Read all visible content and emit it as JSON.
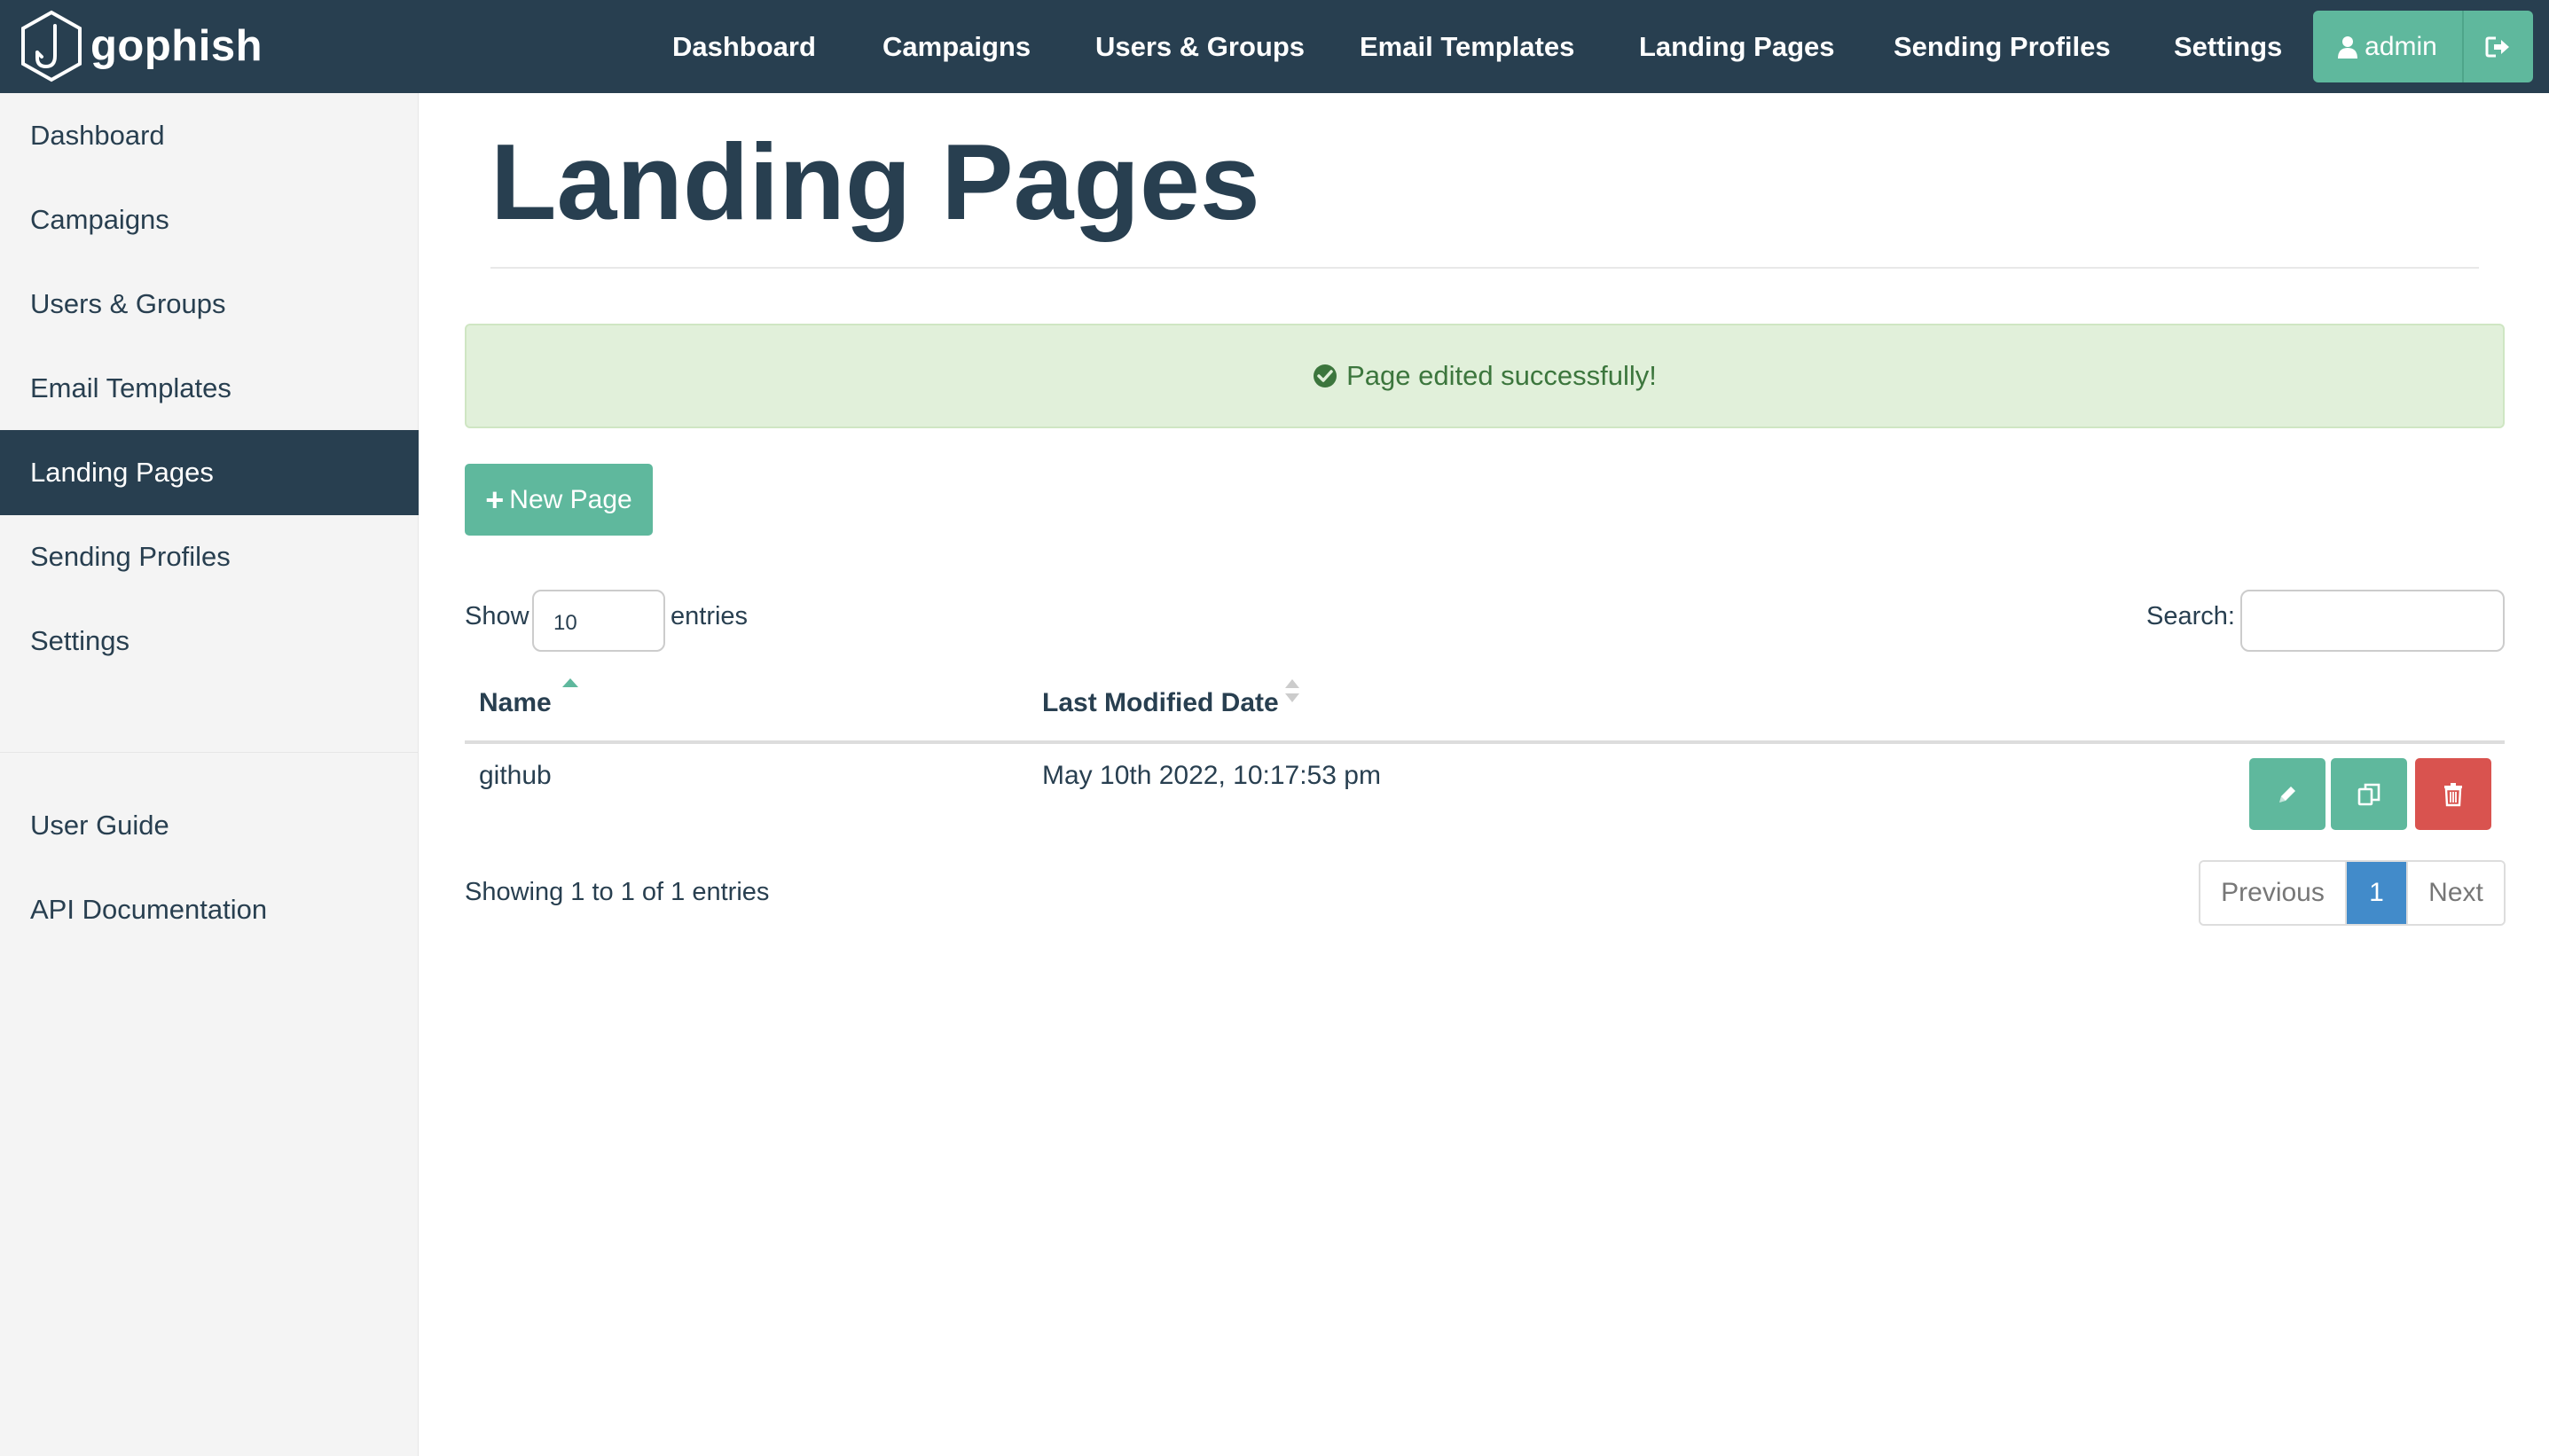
{
  "brand": {
    "name": "gophish",
    "logo_icon": "fishhook-hexagon-icon"
  },
  "topnav": {
    "items": [
      {
        "label": "Dashboard"
      },
      {
        "label": "Campaigns"
      },
      {
        "label": "Users & Groups"
      },
      {
        "label": "Email Templates"
      },
      {
        "label": "Landing Pages"
      },
      {
        "label": "Sending Profiles"
      },
      {
        "label": "Settings"
      }
    ],
    "user_label": "admin",
    "user_icon": "user-icon",
    "logout_icon": "sign-out-icon"
  },
  "sidebar": {
    "items": [
      {
        "label": "Dashboard"
      },
      {
        "label": "Campaigns"
      },
      {
        "label": "Users & Groups"
      },
      {
        "label": "Email Templates"
      },
      {
        "label": "Landing Pages",
        "active": true
      },
      {
        "label": "Sending Profiles"
      },
      {
        "label": "Settings"
      }
    ],
    "links": [
      {
        "label": "User Guide"
      },
      {
        "label": "API Documentation"
      }
    ]
  },
  "page": {
    "title": "Landing Pages"
  },
  "alert": {
    "message": "Page edited successfully!",
    "icon": "check-circle-icon"
  },
  "toolbar": {
    "new_label": "New Page",
    "new_icon": "plus-icon"
  },
  "table_controls": {
    "show_label": "Show",
    "page_size": "10",
    "entries_label": "entries",
    "search_label": "Search:",
    "search_value": ""
  },
  "table": {
    "columns": [
      "Name",
      "Last Modified Date"
    ],
    "rows": [
      {
        "name": "github",
        "modified": "May 10th 2022, 10:17:53 pm"
      }
    ],
    "row_actions": [
      "pencil-icon",
      "copy-icon",
      "trash-icon"
    ]
  },
  "pagination": {
    "info": "Showing 1 to 1 of 1 entries",
    "previous": "Previous",
    "current": "1",
    "next": "Next"
  },
  "colors": {
    "navbar": "#283f50",
    "accent": "#5fb89d",
    "danger": "#d9534f",
    "page_active": "#428bca",
    "alert_bg": "#e1f0da"
  }
}
